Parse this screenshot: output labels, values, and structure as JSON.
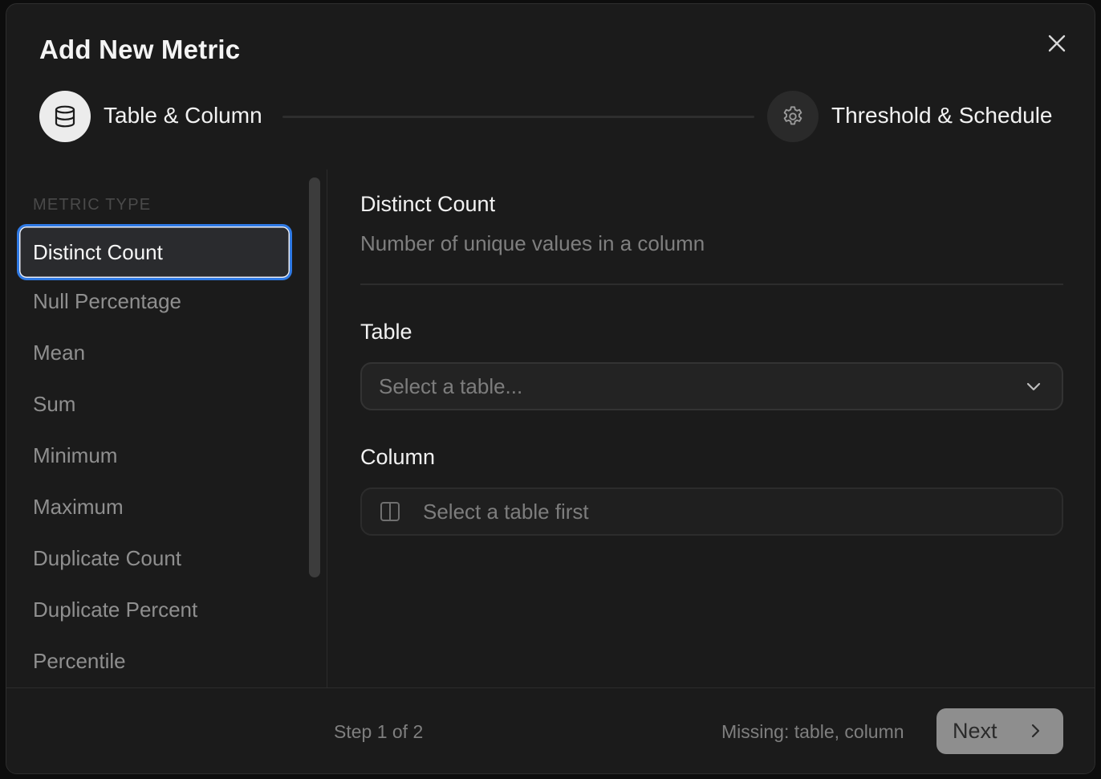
{
  "dialog": {
    "title": "Add New Metric",
    "close_icon": "close-icon"
  },
  "stepper": {
    "steps": [
      {
        "label": "Table & Column",
        "icon": "database-icon",
        "state": "active"
      },
      {
        "label": "Threshold & Schedule",
        "icon": "gear-icon",
        "state": "pending"
      }
    ]
  },
  "metric_type": {
    "section_label": "METRIC TYPE",
    "items": [
      {
        "label": "Distinct Count",
        "selected": true
      },
      {
        "label": "Null Percentage"
      },
      {
        "label": "Mean"
      },
      {
        "label": "Sum"
      },
      {
        "label": "Minimum"
      },
      {
        "label": "Maximum"
      },
      {
        "label": "Duplicate Count"
      },
      {
        "label": "Duplicate Percent"
      },
      {
        "label": "Percentile"
      }
    ]
  },
  "detail": {
    "title": "Distinct Count",
    "description": "Number of unique values in a column",
    "table_label": "Table",
    "table_placeholder": "Select a table...",
    "column_label": "Column",
    "column_placeholder": "Select a table first"
  },
  "footer": {
    "step_text": "Step 1 of 2",
    "missing_text": "Missing: table, column",
    "next_label": "Next"
  },
  "colors": {
    "accent": "#2f7ae5",
    "background": "#1b1b1b",
    "next_button": "#8e8e8e"
  }
}
